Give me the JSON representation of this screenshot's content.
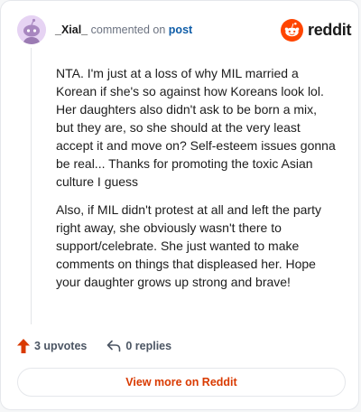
{
  "comment": {
    "username": "_Xial_",
    "action_text": "commented on",
    "link_text": "post",
    "paragraphs": [
      "NTA. I'm just at a loss of why MIL married a Korean if she's so against how Koreans look lol. Her daughters also didn't ask to be born a mix, but they are, so she should at the very least accept it and move on? Self-esteem issues gonna be real... Thanks for promoting the toxic Asian culture I guess",
      "Also, if MIL didn't protest at all and left the party right away, she obviously wasn't there to support/celebrate. She just wanted to make comments on things that displeased her. Hope your daughter grows up strong and brave!"
    ]
  },
  "brand": {
    "name": "reddit",
    "color": "#ff4500"
  },
  "actions": {
    "upvotes": "3 upvotes",
    "replies": "0 replies"
  },
  "footer": {
    "view_more": "View more on Reddit"
  },
  "icons": {
    "avatar": "snoo-avatar-icon",
    "logo": "reddit-logo-icon",
    "upvote": "upvote-arrow-icon",
    "reply": "reply-arrow-icon"
  },
  "colors": {
    "accent": "#d93a00",
    "upvote": "#d93a00",
    "link": "#0f5da8"
  }
}
